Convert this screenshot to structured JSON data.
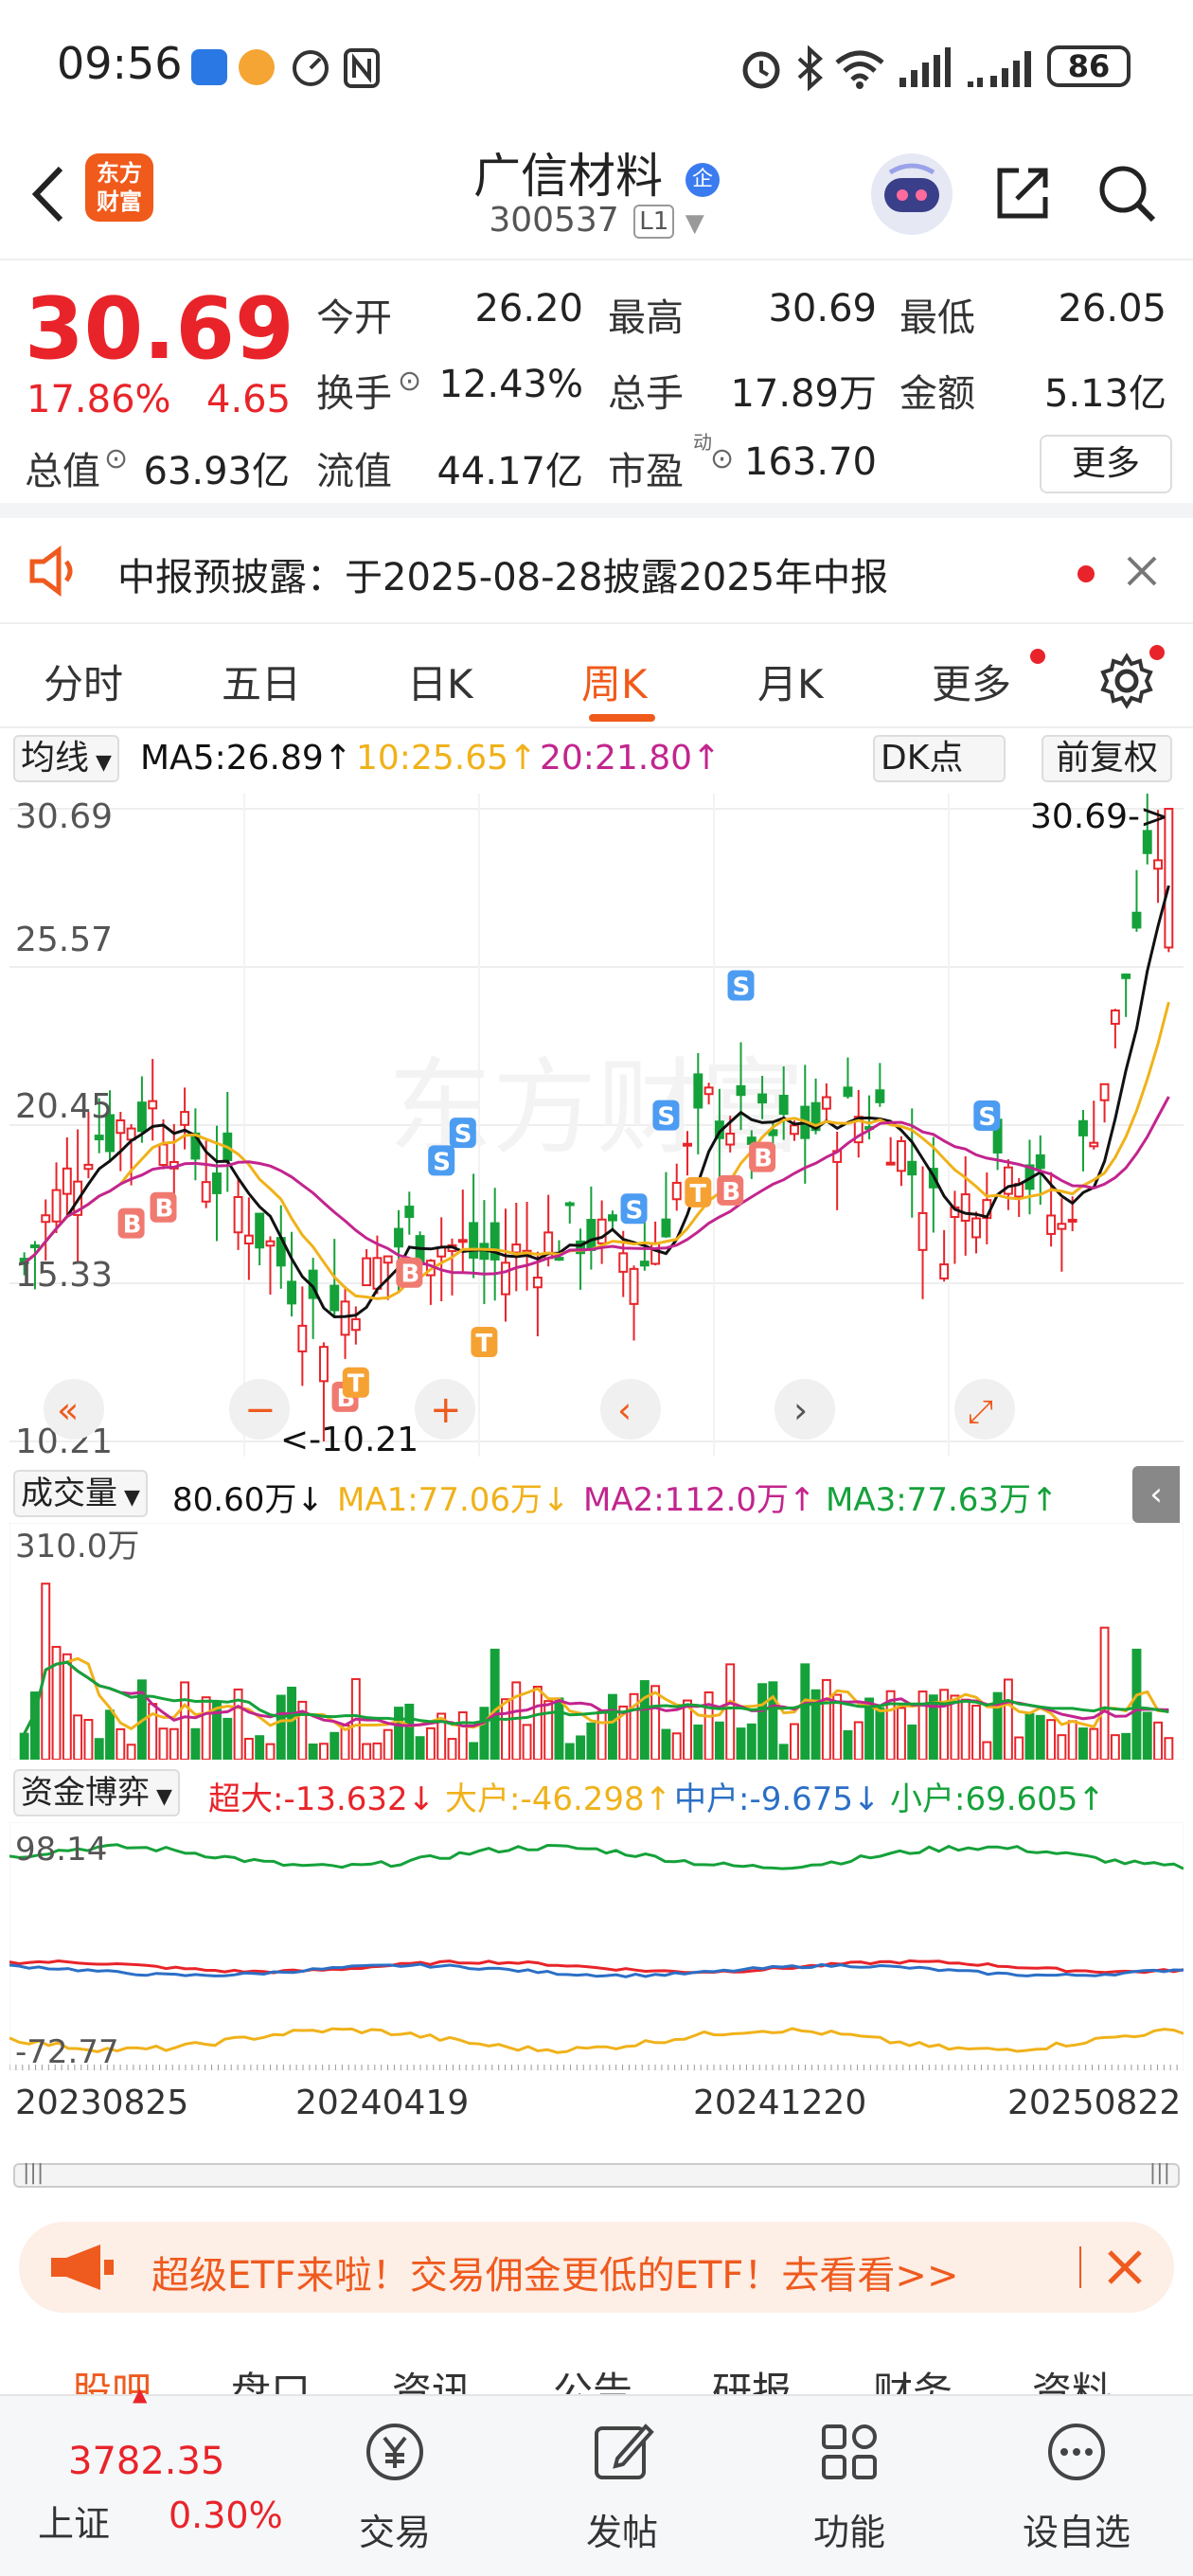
{
  "status_bar": {
    "time": "09:56",
    "battery": "86"
  },
  "header": {
    "logo_line1": "东方",
    "logo_line2": "财富",
    "stock_name": "广信材料",
    "corp_badge": "企",
    "stock_code": "300537",
    "level": "L1"
  },
  "quote": {
    "price": "30.69",
    "pct_change": "17.86%",
    "change": "4.65",
    "fields": [
      {
        "label": "今开",
        "value": "26.20",
        "color": "#e8242a"
      },
      {
        "label": "最高",
        "value": "30.69",
        "color": "#e8242a"
      },
      {
        "label": "最低",
        "value": "26.05",
        "color": "#e8242a"
      },
      {
        "label": "换手",
        "value": "12.43%",
        "color": "#222222"
      },
      {
        "label": "总手",
        "value": "17.89万",
        "color": "#222222"
      },
      {
        "label": "金额",
        "value": "5.13亿",
        "color": "#222222"
      },
      {
        "label": "总值",
        "value": "63.93亿",
        "color": "#222222"
      },
      {
        "label": "流值",
        "value": "44.17亿",
        "color": "#222222"
      },
      {
        "label": "市盈",
        "value": "163.70",
        "color": "#222222"
      }
    ],
    "pe_superscript": "动",
    "more_button": "更多"
  },
  "notice": {
    "text": "中报预披露：于2025-08-28披露2025年中报"
  },
  "tabs": [
    "分时",
    "五日",
    "日K",
    "周K",
    "月K",
    "更多"
  ],
  "active_tab": "周K",
  "ma_bar": {
    "indicator": "均线",
    "ma5": "MA5:26.89↑",
    "ma10": "10:25.65↑",
    "ma20": "20:21.80↑",
    "dk_button": "DK点",
    "adjust_button": "前复权"
  },
  "kline_axis": {
    "y_labels": [
      "30.69",
      "25.57",
      "20.45",
      "15.33",
      "10.21"
    ],
    "max_label": "30.69->",
    "min_label": "<-10.21"
  },
  "volume_bar": {
    "indicator": "成交量",
    "current": "80.60万↓",
    "ma1": "MA1:77.06万↓",
    "ma2": "MA2:112.0万↑",
    "ma3": "MA3:77.63万↑",
    "y_max": "310.0万"
  },
  "fund_bar": {
    "indicator": "资金博弈",
    "super_large": "超大:-13.632↓",
    "large": "大户:-46.298↑",
    "medium": "中户:-9.675↓",
    "small": "小户:69.605↑",
    "y_max": "98.14",
    "y_min": "-72.77"
  },
  "dates": [
    "20230825",
    "20240419",
    "20241220",
    "20250822"
  ],
  "etf_banner": {
    "text": "超级ETF来啦！交易佣金更低的ETF！去看看>>"
  },
  "sub_tabs": [
    "股吧",
    "盘口",
    "资讯",
    "公告",
    "研报",
    "财务",
    "资料"
  ],
  "index": {
    "name": "上证",
    "value": "3782.35",
    "pct": "0.30%"
  },
  "bottom_nav": [
    "交易",
    "发帖",
    "功能",
    "设自选"
  ],
  "colors": {
    "up": "#e8242a",
    "down": "#15a13a",
    "brand": "#f05a1a",
    "ma5": "#111111",
    "ma10": "#f0b21a",
    "ma20": "#c2258e"
  }
}
